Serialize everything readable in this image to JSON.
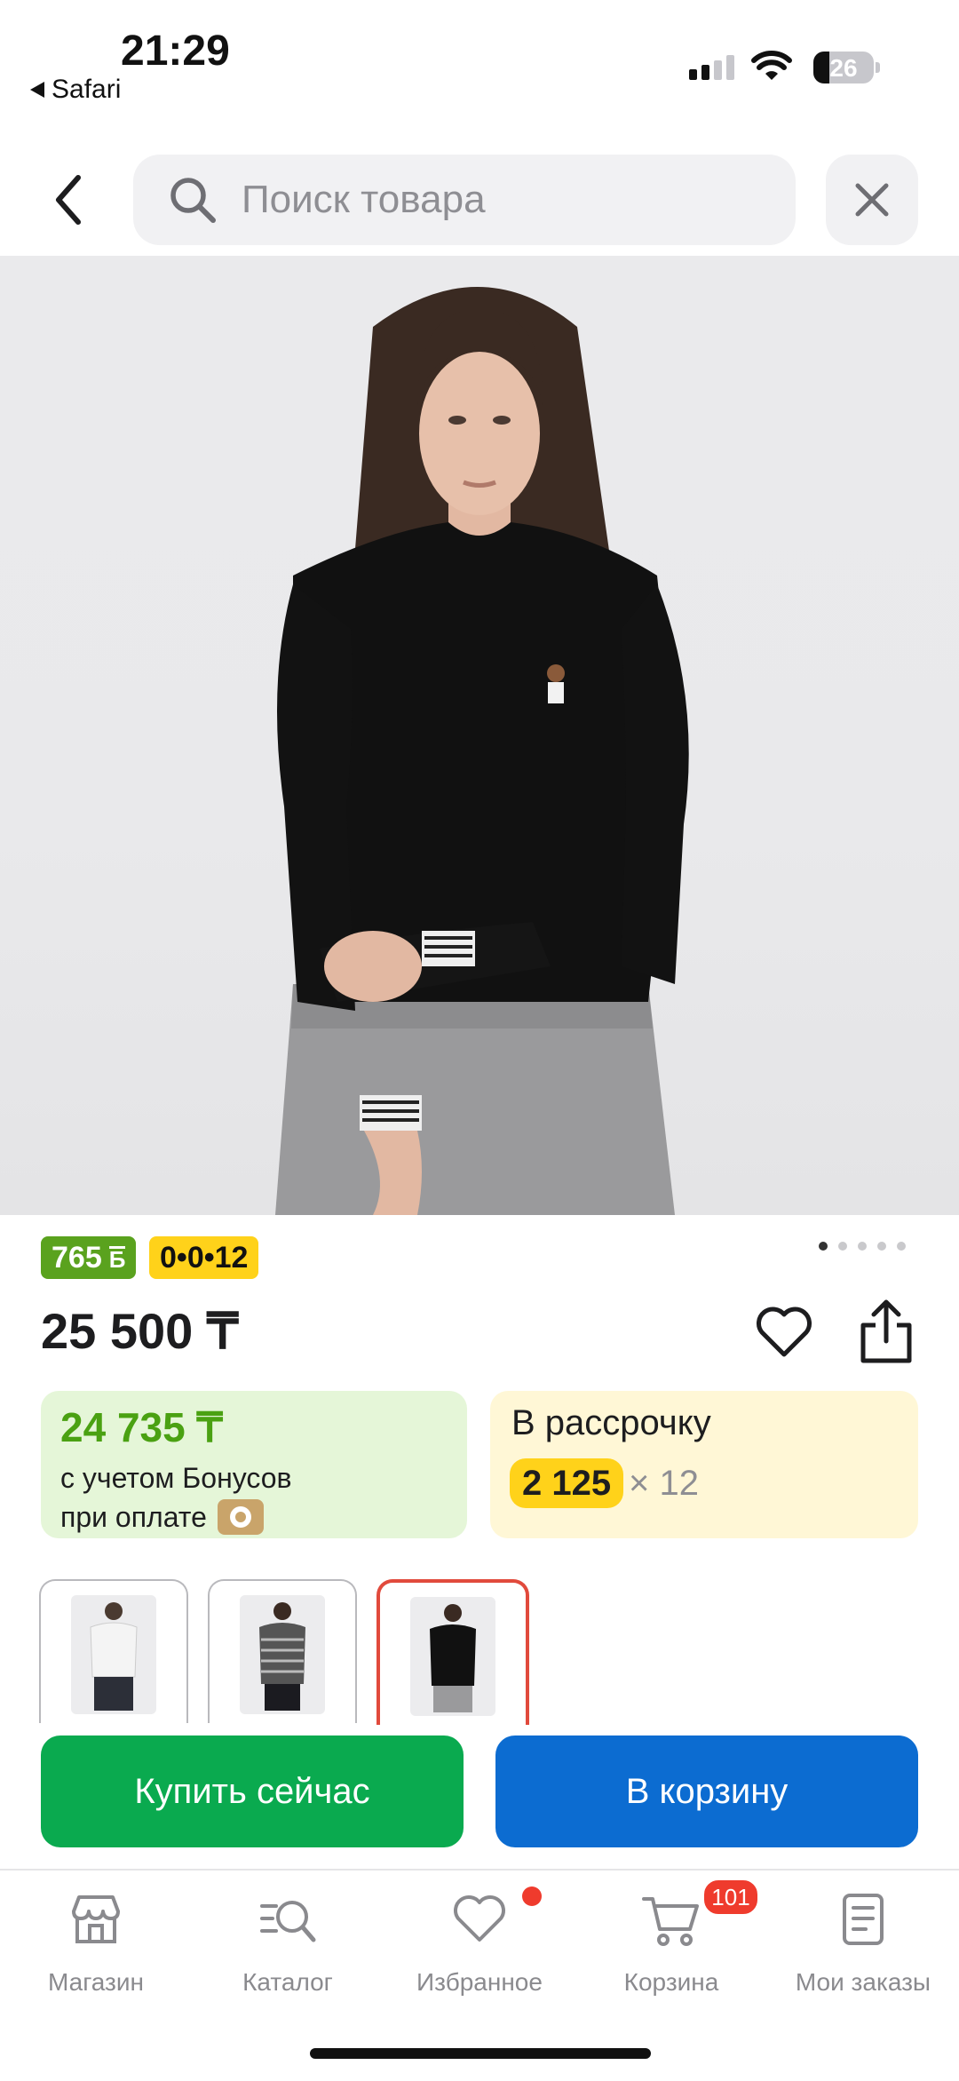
{
  "status_bar": {
    "time": "21:29",
    "back_app": "Safari",
    "battery": "26",
    "battery_level": 0.26
  },
  "search": {
    "placeholder": "Поиск товара"
  },
  "product": {
    "gallery_pages": 5,
    "gallery_active": 0,
    "badges": {
      "bonus_value": "765",
      "bonus_unit": "Б",
      "installment": "0•0•12"
    },
    "price": "25 500 ₸",
    "bonus_card": {
      "amount": "24 735 ₸",
      "line1": "с учетом Бонусов",
      "line2": "при оплате"
    },
    "installment_card": {
      "title": "В рассрочку",
      "monthly": "2 125",
      "multiplier": "× 12"
    },
    "variants": [
      {
        "name": "white",
        "selected": false
      },
      {
        "name": "striped",
        "selected": false
      },
      {
        "name": "black",
        "selected": true
      }
    ]
  },
  "actions": {
    "buy_now": "Купить сейчас",
    "add_to_cart": "В корзину"
  },
  "tabbar": {
    "items": [
      {
        "label": "Магазин",
        "icon": "store-icon"
      },
      {
        "label": "Каталог",
        "icon": "catalog-search-icon"
      },
      {
        "label": "Избранное",
        "icon": "heart-icon"
      },
      {
        "label": "Корзина",
        "icon": "cart-icon"
      },
      {
        "label": "Мои заказы",
        "icon": "orders-icon"
      }
    ],
    "cart_count": "101"
  },
  "colors": {
    "green_buy": "#0aaa4f",
    "blue_cart": "#0c6cd1",
    "bonus_green": "#5aa21e",
    "installment_yellow": "#ffd21a",
    "badge_red": "#ef3b2d"
  }
}
